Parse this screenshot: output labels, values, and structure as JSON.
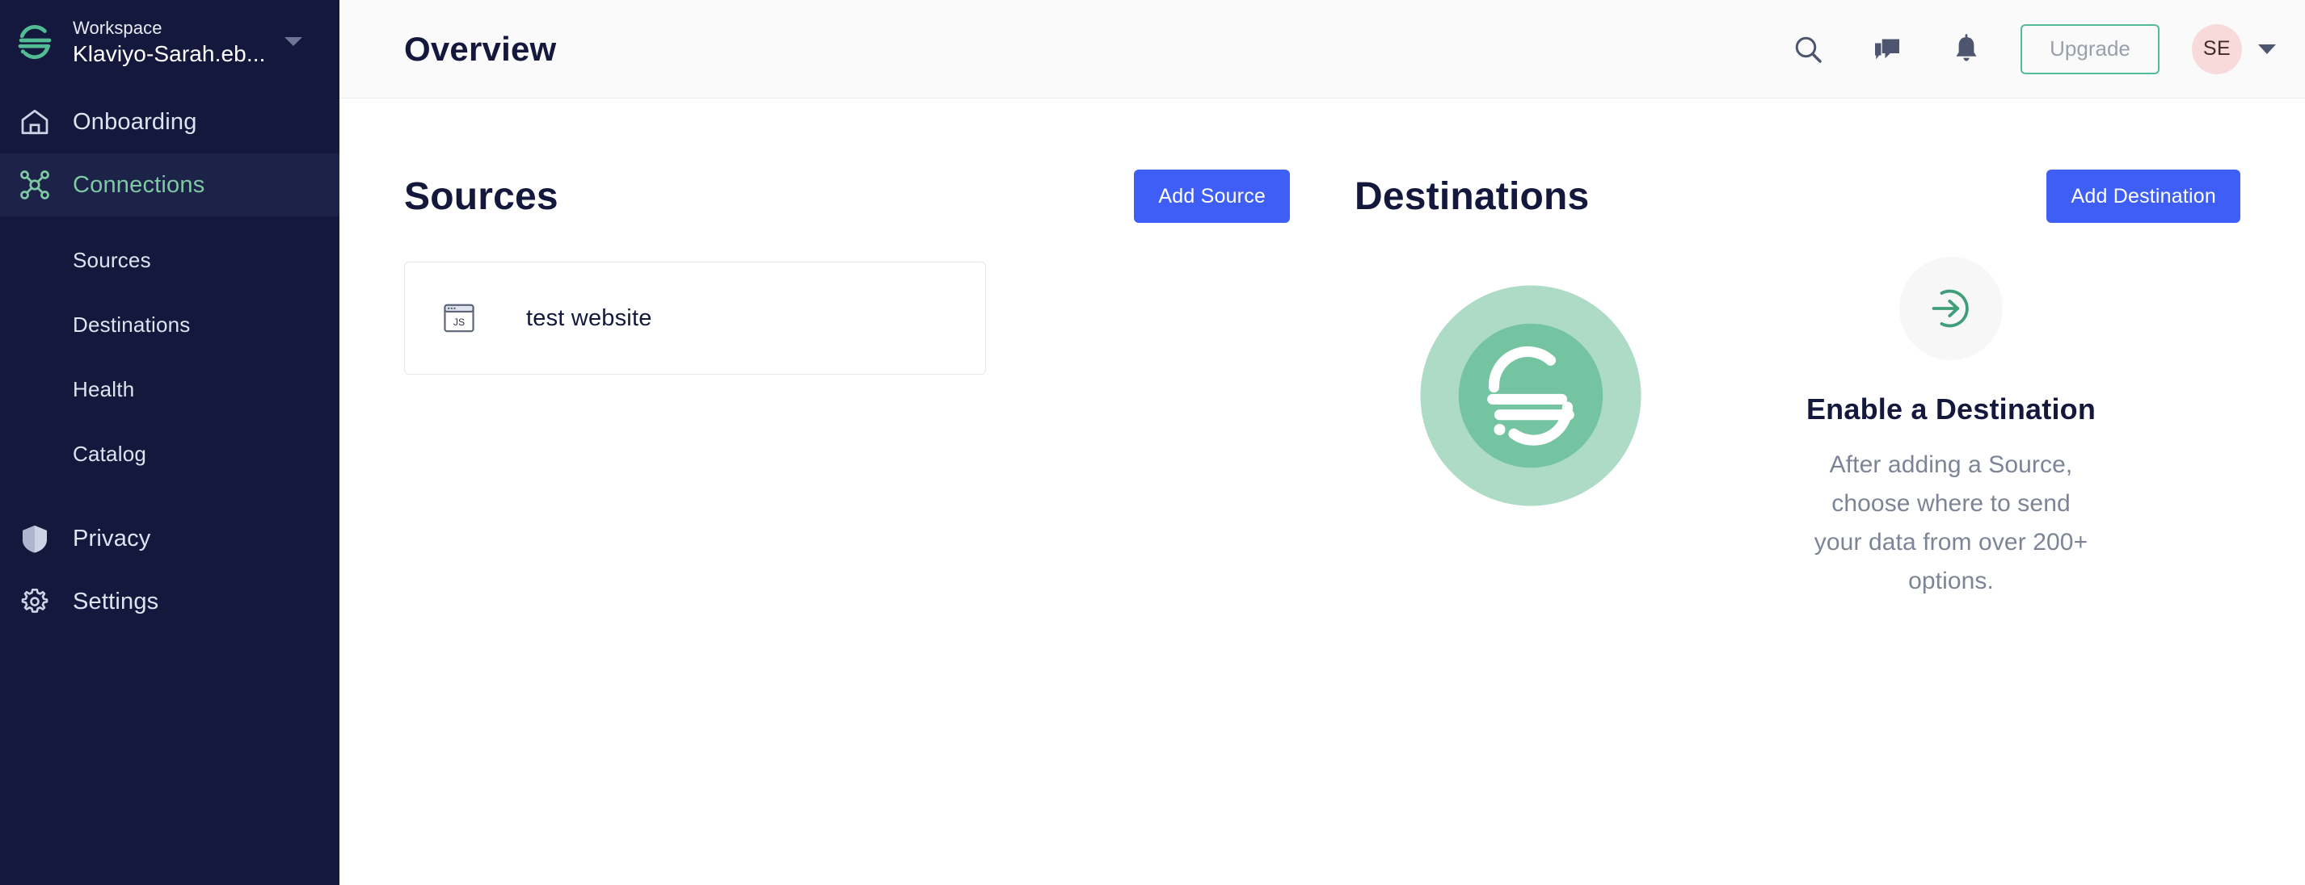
{
  "sidebar": {
    "workspace_label": "Workspace",
    "workspace_name": "Klaviyo-Sarah.eb...",
    "nav": [
      {
        "label": "Onboarding",
        "icon": "home-icon",
        "active": false
      },
      {
        "label": "Connections",
        "icon": "connections-icon",
        "active": true
      },
      {
        "label": "Privacy",
        "icon": "shield-icon",
        "active": false
      },
      {
        "label": "Settings",
        "icon": "gear-icon",
        "active": false
      }
    ],
    "subnav": [
      {
        "label": "Sources"
      },
      {
        "label": "Destinations"
      },
      {
        "label": "Health"
      },
      {
        "label": "Catalog"
      }
    ]
  },
  "topbar": {
    "title": "Overview",
    "search_icon": "search-icon",
    "chat_icon": "chat-bubble-icon",
    "bell_icon": "bell-icon",
    "upgrade_label": "Upgrade",
    "avatar_initials": "SE"
  },
  "sources": {
    "title": "Sources",
    "add_label": "Add Source",
    "items": [
      {
        "name": "test website",
        "icon": "javascript-website-icon"
      }
    ]
  },
  "destinations": {
    "title": "Destinations",
    "add_label": "Add Destination",
    "empty": {
      "logo_icon": "segment-logo-icon",
      "state_icon": "arrow-into-circle-icon",
      "title": "Enable a Destination",
      "body": "After adding a Source, choose where to send your data from over 200+ options."
    }
  },
  "colors": {
    "sidebar_bg": "#13183c",
    "sidebar_active_bg": "#1c2248",
    "accent_green": "#52bd94",
    "primary_blue": "#3e5ef5",
    "avatar_pink": "#f9dada",
    "topbar_bg": "#fafafb"
  }
}
